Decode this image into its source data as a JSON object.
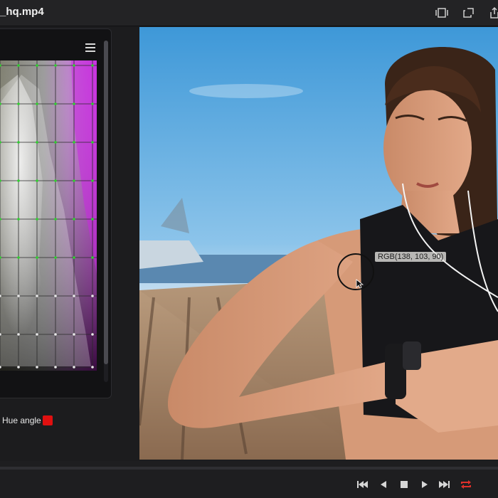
{
  "window": {
    "title": "_hq.mp4",
    "buttons": [
      "clip-icon",
      "popout-icon",
      "share-icon"
    ]
  },
  "scope": {
    "menu_icon": "hamburger-icon",
    "hue_label": "Hue angle",
    "hue_color": "#e01010"
  },
  "viewer": {
    "rgb_readout": "RGB(138, 103, 90)"
  },
  "transport": {
    "controls": [
      "skip-back-icon",
      "step-back-icon",
      "stop-icon",
      "play-icon",
      "skip-forward-icon",
      "loop-icon"
    ],
    "loop_color": "#e0302a"
  }
}
